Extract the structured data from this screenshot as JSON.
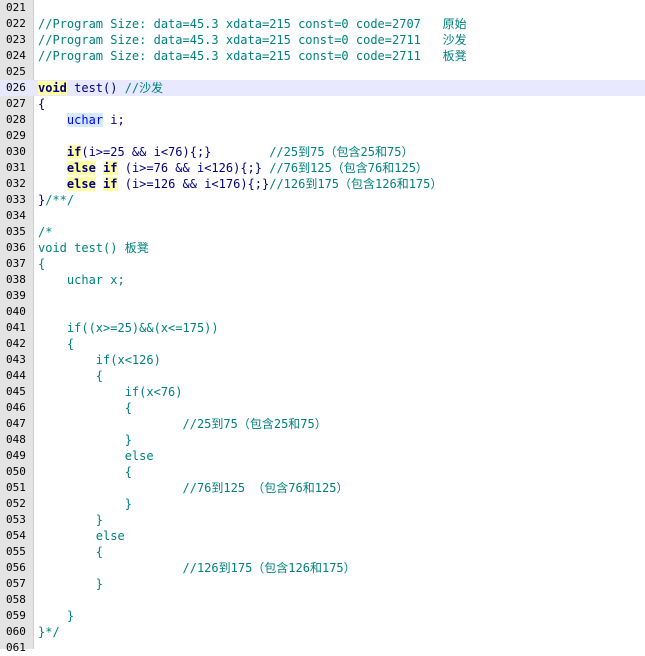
{
  "editor": {
    "lines": [
      {
        "n": "021",
        "tokens": []
      },
      {
        "n": "022",
        "tokens": [
          {
            "t": "comment",
            "s": "//Program Size: data=45.3 xdata=215 const=0 code=2707   原始"
          }
        ]
      },
      {
        "n": "023",
        "tokens": [
          {
            "t": "comment",
            "s": "//Program Size: data=45.3 xdata=215 const=0 code=2711   沙发"
          }
        ]
      },
      {
        "n": "024",
        "tokens": [
          {
            "t": "comment",
            "s": "//Program Size: data=45.3 xdata=215 const=0 code=2711   板凳"
          }
        ]
      },
      {
        "n": "025",
        "tokens": []
      },
      {
        "n": "026",
        "current": true,
        "tokens": [
          {
            "t": "kw",
            "s": "void"
          },
          {
            "t": "plain",
            "s": " test() "
          },
          {
            "t": "comment",
            "s": "//沙发"
          }
        ]
      },
      {
        "n": "027",
        "tokens": [
          {
            "t": "plain",
            "s": "{"
          }
        ]
      },
      {
        "n": "028",
        "tokens": [
          {
            "t": "plain",
            "s": "    "
          },
          {
            "t": "type",
            "s": "uchar"
          },
          {
            "t": "plain",
            "s": " i;"
          }
        ]
      },
      {
        "n": "029",
        "tokens": []
      },
      {
        "n": "030",
        "tokens": [
          {
            "t": "plain",
            "s": "    "
          },
          {
            "t": "kw",
            "s": "if"
          },
          {
            "t": "plain",
            "s": "(i>=25 && i<76){;}        "
          },
          {
            "t": "comment",
            "s": "//25到75（包含25和75）"
          }
        ]
      },
      {
        "n": "031",
        "tokens": [
          {
            "t": "plain",
            "s": "    "
          },
          {
            "t": "kw",
            "s": "else"
          },
          {
            "t": "plain",
            "s": " "
          },
          {
            "t": "kw",
            "s": "if"
          },
          {
            "t": "plain",
            "s": " (i>=76 && i<126){;} "
          },
          {
            "t": "comment",
            "s": "//76到125（包含76和125）"
          }
        ]
      },
      {
        "n": "032",
        "tokens": [
          {
            "t": "plain",
            "s": "    "
          },
          {
            "t": "kw",
            "s": "else"
          },
          {
            "t": "plain",
            "s": " "
          },
          {
            "t": "kw",
            "s": "if"
          },
          {
            "t": "plain",
            "s": " (i>=126 && i<176){;}"
          },
          {
            "t": "comment",
            "s": "//126到175（包含126和175）"
          }
        ]
      },
      {
        "n": "033",
        "tokens": [
          {
            "t": "plain",
            "s": "}"
          },
          {
            "t": "comment",
            "s": "/**/"
          }
        ]
      },
      {
        "n": "034",
        "tokens": []
      },
      {
        "n": "035",
        "tokens": [
          {
            "t": "comment",
            "s": "/*"
          }
        ]
      },
      {
        "n": "036",
        "tokens": [
          {
            "t": "comment",
            "s": "void test() 板凳"
          }
        ]
      },
      {
        "n": "037",
        "tokens": [
          {
            "t": "comment",
            "s": "{"
          }
        ]
      },
      {
        "n": "038",
        "tokens": [
          {
            "t": "comment",
            "s": "    uchar x;"
          }
        ]
      },
      {
        "n": "039",
        "tokens": []
      },
      {
        "n": "040",
        "tokens": []
      },
      {
        "n": "041",
        "tokens": [
          {
            "t": "comment",
            "s": "    if((x>=25)&&(x<=175))"
          }
        ]
      },
      {
        "n": "042",
        "tokens": [
          {
            "t": "comment",
            "s": "    {"
          }
        ]
      },
      {
        "n": "043",
        "tokens": [
          {
            "t": "comment",
            "s": "        if(x<126)"
          }
        ]
      },
      {
        "n": "044",
        "tokens": [
          {
            "t": "comment",
            "s": "        {"
          }
        ]
      },
      {
        "n": "045",
        "tokens": [
          {
            "t": "comment",
            "s": "            if(x<76)"
          }
        ]
      },
      {
        "n": "046",
        "tokens": [
          {
            "t": "comment",
            "s": "            {"
          }
        ]
      },
      {
        "n": "047",
        "tokens": [
          {
            "t": "comment",
            "s": "                    //25到75（包含25和75）"
          }
        ]
      },
      {
        "n": "048",
        "tokens": [
          {
            "t": "comment",
            "s": "            }"
          }
        ]
      },
      {
        "n": "049",
        "tokens": [
          {
            "t": "comment",
            "s": "            else"
          }
        ]
      },
      {
        "n": "050",
        "tokens": [
          {
            "t": "comment",
            "s": "            {"
          }
        ]
      },
      {
        "n": "051",
        "tokens": [
          {
            "t": "comment",
            "s": "                    //76到125 （包含76和125）"
          }
        ]
      },
      {
        "n": "052",
        "tokens": [
          {
            "t": "comment",
            "s": "            }"
          }
        ]
      },
      {
        "n": "053",
        "tokens": [
          {
            "t": "comment",
            "s": "        }"
          }
        ]
      },
      {
        "n": "054",
        "tokens": [
          {
            "t": "comment",
            "s": "        else"
          }
        ]
      },
      {
        "n": "055",
        "tokens": [
          {
            "t": "comment",
            "s": "        {"
          }
        ]
      },
      {
        "n": "056",
        "tokens": [
          {
            "t": "comment",
            "s": "                    //126到175（包含126和175）"
          }
        ]
      },
      {
        "n": "057",
        "tokens": [
          {
            "t": "comment",
            "s": "        }"
          }
        ]
      },
      {
        "n": "058",
        "tokens": []
      },
      {
        "n": "059",
        "tokens": [
          {
            "t": "comment",
            "s": "    }"
          }
        ]
      },
      {
        "n": "060",
        "tokens": [
          {
            "t": "comment",
            "s": "}*/"
          }
        ]
      },
      {
        "n": "061",
        "tokens": []
      }
    ]
  },
  "colors": {
    "comment": "#008080",
    "keyword": "#000080",
    "keyword_highlight": "#ffffa0",
    "type": "#0000ff",
    "type_highlight": "#d6eaff",
    "current_line": "#e8e8ff",
    "gutter": "#e4e4e4"
  }
}
